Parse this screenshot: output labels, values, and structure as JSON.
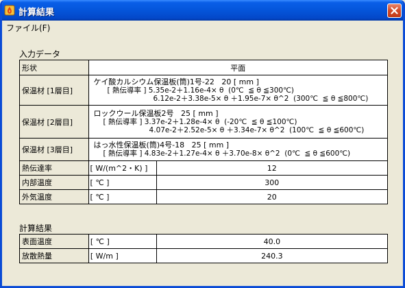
{
  "window": {
    "title": "計算結果"
  },
  "menu": {
    "file": "ファイル(F)"
  },
  "input": {
    "section_title": "入力データ",
    "shape_label": "形状",
    "shape_value": "平面",
    "layers": [
      {
        "label": "保温材 [1層目]",
        "material": "ケイ酸カルシウム保温板(筒)1号-22   20 [ mm ]",
        "conductivity_header": "[ 熱伝導率 ] 5.35e-2＋1.16e-4× θ  (0℃  ≦ θ ≦300℃)",
        "conductivity_line2": "6.12e-2＋3.38e-5× θ ＋1.95e-7× θ^2  (300℃  ≦ θ ≦800℃)"
      },
      {
        "label": "保温材 [2層目]",
        "material": "ロックウール保温板2号   25 [ mm ]",
        "conductivity_header": "[ 熱伝導率 ] 3.37e-2＋1.28e-4× θ  (-20℃  ≦ θ ≦100℃)",
        "conductivity_line2": "4.07e-2＋2.52e-5× θ ＋3.34e-7× θ^2  (100℃  ≦ θ ≦600℃)"
      },
      {
        "label": "保温材 [3層目]",
        "material": "はっ水性保温板(筒)4号-18   25 [ mm ]",
        "conductivity_header": "[ 熱伝導率 ] 4.83e-2＋1.27e-4× θ ＋3.70e-8× θ^2  (0℃  ≦ θ ≦600℃)"
      }
    ],
    "rows": [
      {
        "label": "熱伝達率",
        "unit": "[ W/(m^2・K) ]",
        "value": "12"
      },
      {
        "label": "内部温度",
        "unit": "[ ℃ ]",
        "value": "300"
      },
      {
        "label": "外気温度",
        "unit": "[ ℃ ]",
        "value": "20"
      }
    ]
  },
  "result": {
    "section_title": "計算結果",
    "rows": [
      {
        "label": "表面温度",
        "unit": "[ ℃ ]",
        "value": "40.0"
      },
      {
        "label": "放散熱量",
        "unit": "[ W/m ]",
        "value": "240.3"
      }
    ]
  }
}
